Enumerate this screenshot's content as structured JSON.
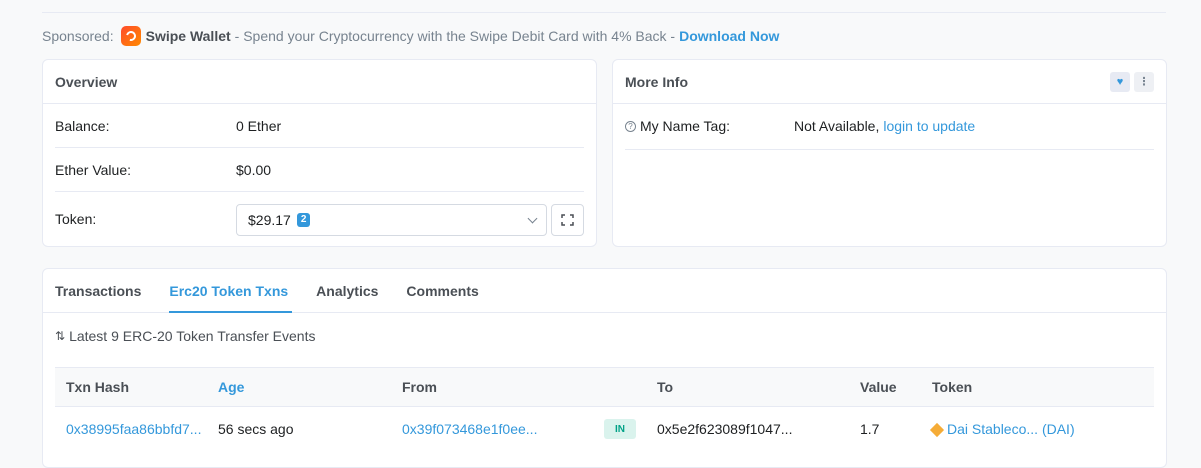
{
  "sponsor": {
    "label": "Sponsored:",
    "brand": "Swipe Wallet",
    "text": "- Spend your Cryptocurrency with the Swipe Debit Card with 4% Back -",
    "link": "Download Now"
  },
  "overview": {
    "title": "Overview",
    "balance_label": "Balance:",
    "balance_value": "0 Ether",
    "ether_value_label": "Ether Value:",
    "ether_value": "$0.00",
    "token_label": "Token:",
    "token_value": "$29.17",
    "token_count": "2"
  },
  "more_info": {
    "title": "More Info",
    "name_tag_label": "My Name Tag:",
    "name_tag_value": "Not Available,",
    "name_tag_link": "login to update"
  },
  "tabs": [
    "Transactions",
    "Erc20 Token Txns",
    "Analytics",
    "Comments"
  ],
  "active_tab": "Erc20 Token Txns",
  "events_text": "Latest 9 ERC-20 Token Transfer Events",
  "table": {
    "headers": [
      "Txn Hash",
      "Age",
      "From",
      "To",
      "Value",
      "Token"
    ],
    "rows": [
      {
        "hash": "0x38995faa86bbfd7...",
        "age": "56 secs ago",
        "from": "0x39f073468e1f0ee...",
        "direction": "IN",
        "to": "0x5e2f623089f1047...",
        "value": "1.7",
        "token": "Dai Stableco... (DAI)"
      }
    ]
  },
  "colors": {
    "accent": "#3498db",
    "in_badge_bg": "#daf3ed",
    "in_badge_text": "#00a186"
  }
}
